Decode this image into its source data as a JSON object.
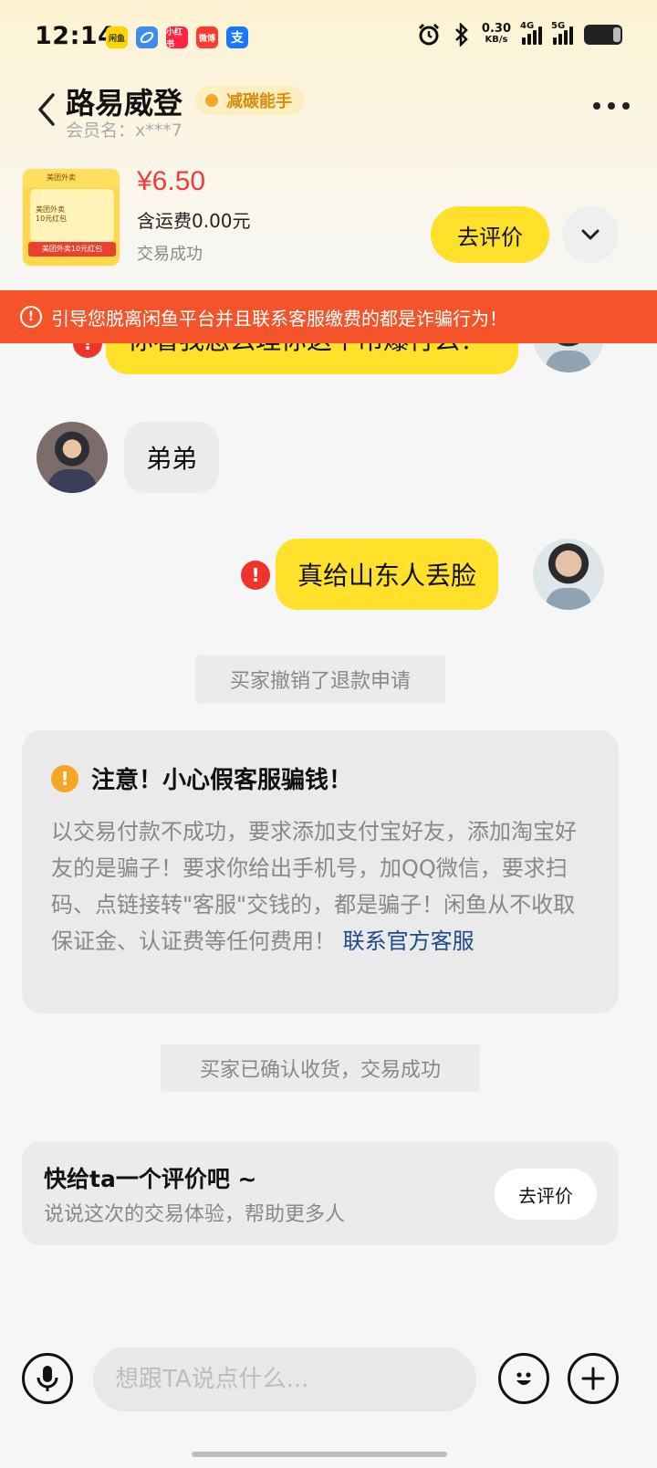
{
  "status_bar": {
    "time": "12:14",
    "apps": [
      "闲鱼",
      "",
      "小红书",
      "微博",
      "支"
    ],
    "net_speed_value": "0.30",
    "net_speed_unit": "KB/s",
    "sig1_label": "4G",
    "sig2_label": "5G"
  },
  "header": {
    "seller_name": "路易威登",
    "badge": "减碳能手",
    "member": "会员名：x***7"
  },
  "product": {
    "thumb_brand": "美团外卖",
    "thumb_line1": "美团外卖",
    "thumb_line2": "10元红包",
    "thumb_band": "美团外卖10元红包",
    "price": "¥6.50",
    "shipping": "含运费0.00元",
    "status": "交易成功",
    "review_button": "去评价"
  },
  "warning_bar": {
    "text": "引导您脱离闲鱼平台并且联系客服缴费的都是诈骗行为！"
  },
  "messages": [
    {
      "from": "me",
      "text": "你看我怎么理你这个吊爆行么！",
      "failed": true
    },
    {
      "from": "other",
      "text": "弟弟"
    },
    {
      "from": "me",
      "text": "真给山东人丢脸",
      "failed": true
    }
  ],
  "system": {
    "refund_cancelled": "买家撤销了退款申请",
    "confirmed": "买家已确认收货，交易成功"
  },
  "notice": {
    "title": "注意！小心假客服骗钱！",
    "body": "以交易付款不成功，要求添加支付宝好友，添加淘宝好友的是骗子！要求你给出手机号，加QQ微信，要求扫码、点链接转\"客服\"交钱的，都是骗子！闲鱼从不收取保证金、认证费等任何费用！",
    "link": "联系官方客服"
  },
  "review_card": {
    "title": "快给ta一个评价吧 ~",
    "subtitle": "说说这次的交易体验，帮助更多人",
    "button": "去评价"
  },
  "input_bar": {
    "placeholder": "想跟TA说点什么..."
  },
  "colors": {
    "accent_yellow": "#ffe02a",
    "price_red": "#ee3d3d",
    "warning_orange": "#f5542b",
    "link_blue": "#1d4a8a"
  }
}
